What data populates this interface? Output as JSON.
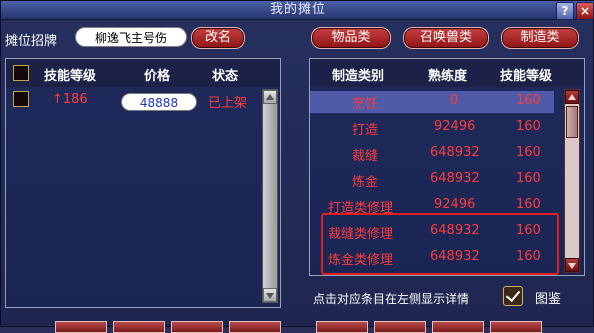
{
  "window": {
    "title": "我的摊位",
    "help_label": "?",
    "close_label": "×"
  },
  "toprow": {
    "sign_label": "摊位招牌",
    "stall_name": "柳逸飞主号伤",
    "rename_label": "改名",
    "tabs": [
      "物品类",
      "召唤兽类",
      "制造类"
    ]
  },
  "left": {
    "headers": {
      "skill_level": "技能等级",
      "price": "价格",
      "status": "状态"
    },
    "rows": [
      {
        "skill_level": "↑186",
        "price": "48888",
        "status": "已上架"
      }
    ]
  },
  "right": {
    "headers": {
      "category": "制造类别",
      "proficiency": "熟练度",
      "skill_level": "技能等级"
    },
    "rows": [
      {
        "category": "烹饪",
        "proficiency": "0",
        "skill_level": "160"
      },
      {
        "category": "打造",
        "proficiency": "92496",
        "skill_level": "160"
      },
      {
        "category": "裁缝",
        "proficiency": "648932",
        "skill_level": "160"
      },
      {
        "category": "炼金",
        "proficiency": "648932",
        "skill_level": "160"
      },
      {
        "category": "打造类修理",
        "proficiency": "92496",
        "skill_level": "160"
      },
      {
        "category": "裁缝类修理",
        "proficiency": "648932",
        "skill_level": "160"
      },
      {
        "category": "炼金类修理",
        "proficiency": "648932",
        "skill_level": "160"
      }
    ],
    "hint": "点击对应条目在左侧显示详情",
    "illustration_label": "图鉴",
    "illustration_checked": true
  },
  "colors": {
    "accent_red": "#ff3b3b",
    "panel_bg": "#1e2a5b",
    "selected_row": "#4f5aa8"
  },
  "icons": [
    "help-icon",
    "close-icon",
    "scroll-up-icon",
    "scroll-down-icon",
    "check-icon"
  ]
}
